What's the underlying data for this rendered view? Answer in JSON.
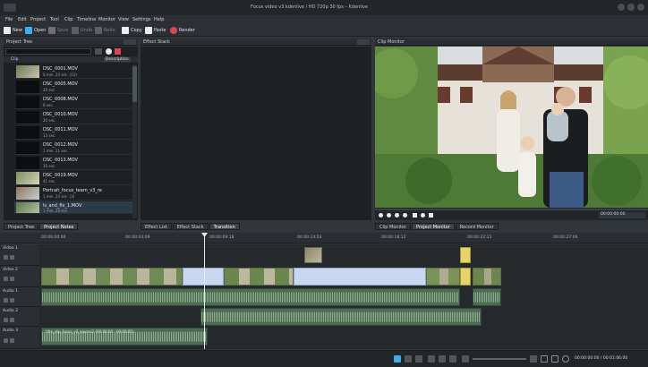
{
  "window": {
    "title": "Focus video v3.kdenlive / HD 720p 30 fps – Kdenlive"
  },
  "menu": [
    "File",
    "Edit",
    "Project",
    "Tool",
    "Clip",
    "Timeline",
    "Monitor",
    "View",
    "Settings",
    "Help"
  ],
  "toolbar": {
    "new_label": "New",
    "open_label": "Open",
    "save_label": "Save",
    "undo_label": "Undo",
    "redo_label": "Redo",
    "copy_label": "Copy",
    "paste_label": "Paste",
    "render_label": "Render"
  },
  "project_tree": {
    "title": "Project Tree",
    "search_placeholder": "",
    "col_clip": "Clip",
    "col_desc": "Description",
    "clips": [
      {
        "name": "DSC_0001.MOV",
        "duration": "0 min. 24 sec. (12)"
      },
      {
        "name": "DSC_0005.MOV",
        "duration": "20 sec."
      },
      {
        "name": "DSC_0008.MOV",
        "duration": "8 sec."
      },
      {
        "name": "DSC_0010.MOV",
        "duration": "20 sec."
      },
      {
        "name": "DSC_0011.MOV",
        "duration": "13 sec."
      },
      {
        "name": "DSC_0012.MOV",
        "duration": "1 min. 21 sec."
      },
      {
        "name": "DSC_0013.MOV",
        "duration": "35 sec."
      },
      {
        "name": "DSC_0019.MOV",
        "duration": "41 sec."
      },
      {
        "name": "Portrait_focus_team_v3_re",
        "duration": "1 min. 24 sec. (3)"
      },
      {
        "name": "ls_and_fix_1.MOV",
        "duration": "1 min. 24 sec."
      }
    ]
  },
  "effect_stack": {
    "title": "Effect Stack"
  },
  "clip_monitor": {
    "title": "Clip Monitor",
    "timecode": "00:00:00:00"
  },
  "bottom_tabs_left": [
    "Project Tree",
    "Project Notes"
  ],
  "bottom_tabs_mid": [
    "Effect List",
    "Effect Stack",
    "Transition"
  ],
  "bottom_tabs_right": [
    "Clip Monitor",
    "Project Monitor",
    "Record Monitor"
  ],
  "timeline": {
    "ruler": [
      "00:00:00:00",
      "00:00:04:09",
      "00:00:09:18",
      "00:00:14:03",
      "00:00:18:12",
      "00:00:22:21",
      "00:00:27:06"
    ],
    "tracks": [
      "Video 1",
      "Video 2",
      "Audio 1",
      "Audio 2",
      "Audio 3"
    ],
    "title_clip_label": "title_clip_focus_v3_source2 (00:00:00 - 00:00:05)"
  },
  "status": {
    "timecode": "00:00:00:00 / 00:01:06:00"
  },
  "colors": {
    "accent": "#3daee9",
    "video_clip": "#8a9a6c",
    "audio_clip": "#4d6b53",
    "selected_clip": "#c9d8f0",
    "render_icon": "#da4453"
  }
}
